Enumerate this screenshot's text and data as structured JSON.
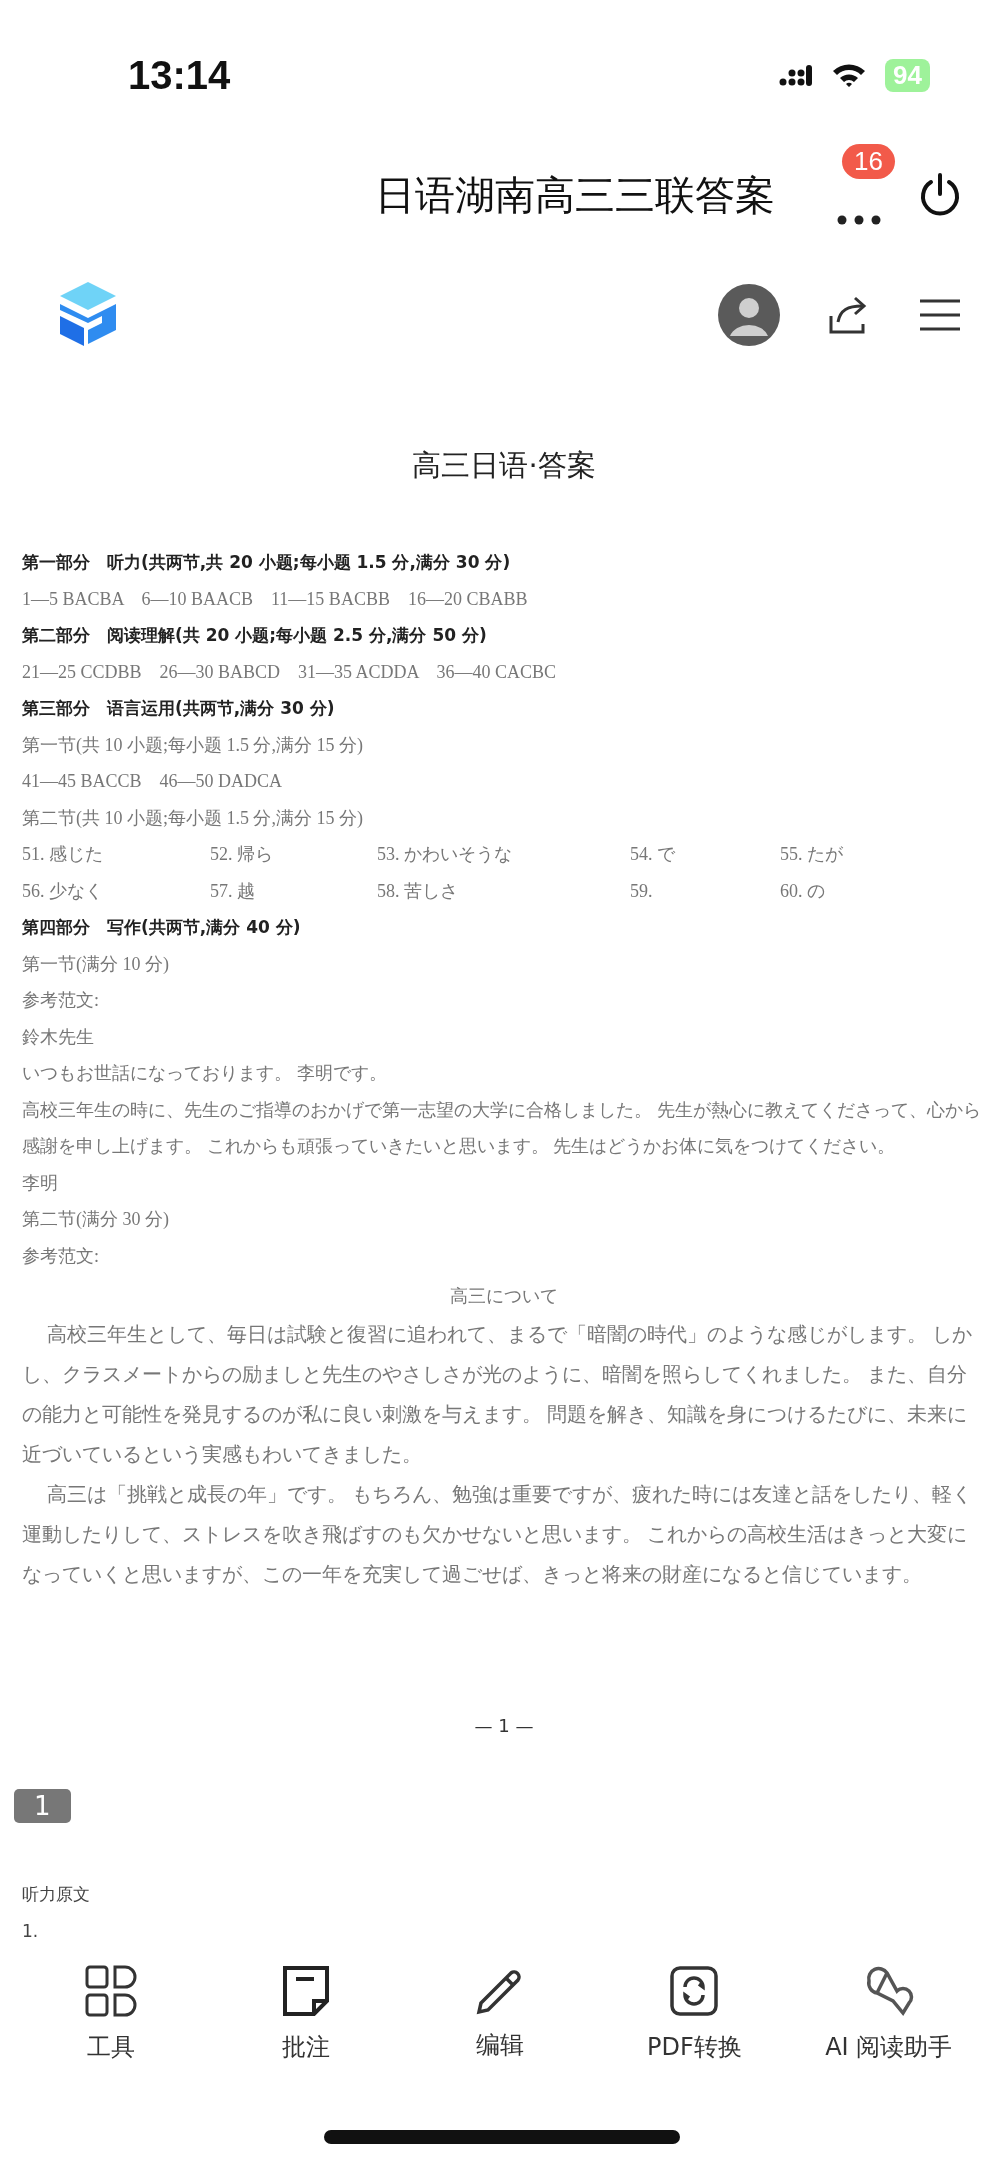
{
  "status_bar": {
    "time": "13:14",
    "battery": "94"
  },
  "header": {
    "title": "日语湖南高三三联答案",
    "badge": "16"
  },
  "document": {
    "title": "高三日语·答案",
    "blocks": [
      {
        "kind": "heading",
        "text": "第一部分　听力(共两节,共 20 小题;每小题 1.5 分,满分 30 分)"
      },
      {
        "kind": "text",
        "text": "1—5 BACBA　6—10 BAACB　11—15 BACBB　16—20 CBABB"
      },
      {
        "kind": "heading",
        "text": "第二部分　阅读理解(共 20 小题;每小题 2.5 分,满分 50 分)"
      },
      {
        "kind": "text",
        "text": "21—25 CCDBB　26—30 BABCD　31—35 ACDDA　36—40 CACBC"
      },
      {
        "kind": "heading",
        "text": "第三部分　语言运用(共两节,满分 30 分)"
      },
      {
        "kind": "text",
        "text": "第一节(共 10 小题;每小题 1.5 分,满分 15 分)"
      },
      {
        "kind": "text",
        "text": "41—45 BACCB　46—50 DADCA"
      },
      {
        "kind": "text",
        "text": "第二节(共 10 小题;每小题 1.5 分,满分 15 分)"
      },
      {
        "kind": "grid",
        "cells": [
          "51. 感じた",
          "52. 帰ら",
          "53. かわいそうな",
          "54. で",
          "55. たが"
        ]
      },
      {
        "kind": "grid",
        "cells": [
          "56. 少なく",
          "57. 越",
          "58. 苦しさ",
          "59.",
          "60. の"
        ]
      },
      {
        "kind": "heading",
        "text": "第四部分　写作(共两节,满分 40 分)"
      },
      {
        "kind": "text",
        "text": "第一节(满分 10 分)"
      },
      {
        "kind": "text",
        "text": "参考范文:"
      },
      {
        "kind": "text",
        "text": "鈴木先生"
      },
      {
        "kind": "text",
        "text": "いつもお世話になっております。 李明です。"
      },
      {
        "kind": "text",
        "text": "高校三年生の時に、先生のご指導のおかげで第一志望の大学に合格しました。 先生が熱心に教えてくださって、心から感謝を申し上げます。 これからも頑張っていきたいと思います。 先生はどうかお体に気をつけてください。"
      },
      {
        "kind": "text",
        "text": "李明"
      },
      {
        "kind": "text",
        "text": "第二节(满分 30 分)"
      },
      {
        "kind": "text",
        "text": "参考范文:"
      },
      {
        "kind": "center",
        "text": "高三について"
      },
      {
        "kind": "para",
        "text": "高校三年生として、毎日は試験と復習に追われて、まるで「暗闇の時代」のような感じがします。 しかし、クラスメートからの励ましと先生のやさしさが光のように、暗闇を照らしてくれました。 また、自分の能力と可能性を発見するのが私に良い刺激を与えます。 問題を解き、知識を身につけるたびに、未来に近づいているという実感もわいてきました。"
      },
      {
        "kind": "para",
        "text": "高三は「挑戦と成長の年」です。 もちろん、勉強は重要ですが、疲れた時には友達と話をしたり、軽く運動したりして、ストレスを吹き飛ばすのも欠かせないと思います。 これからの高校生活はきっと大変になっていくと思いますが、この一年を充実して過ごせば、きっと将来の財産になると信じています。"
      }
    ],
    "page_number": "— 1 —"
  },
  "page_badge": "1",
  "next_page": {
    "title": "听力原文",
    "first_line": "1."
  },
  "toolbar": [
    {
      "kind": "tools",
      "label": "工具"
    },
    {
      "kind": "note",
      "label": "批注"
    },
    {
      "kind": "edit",
      "label": "编辑"
    },
    {
      "kind": "convert",
      "label": "PDF转换"
    },
    {
      "kind": "ai",
      "label": "AI 阅读助手"
    }
  ]
}
